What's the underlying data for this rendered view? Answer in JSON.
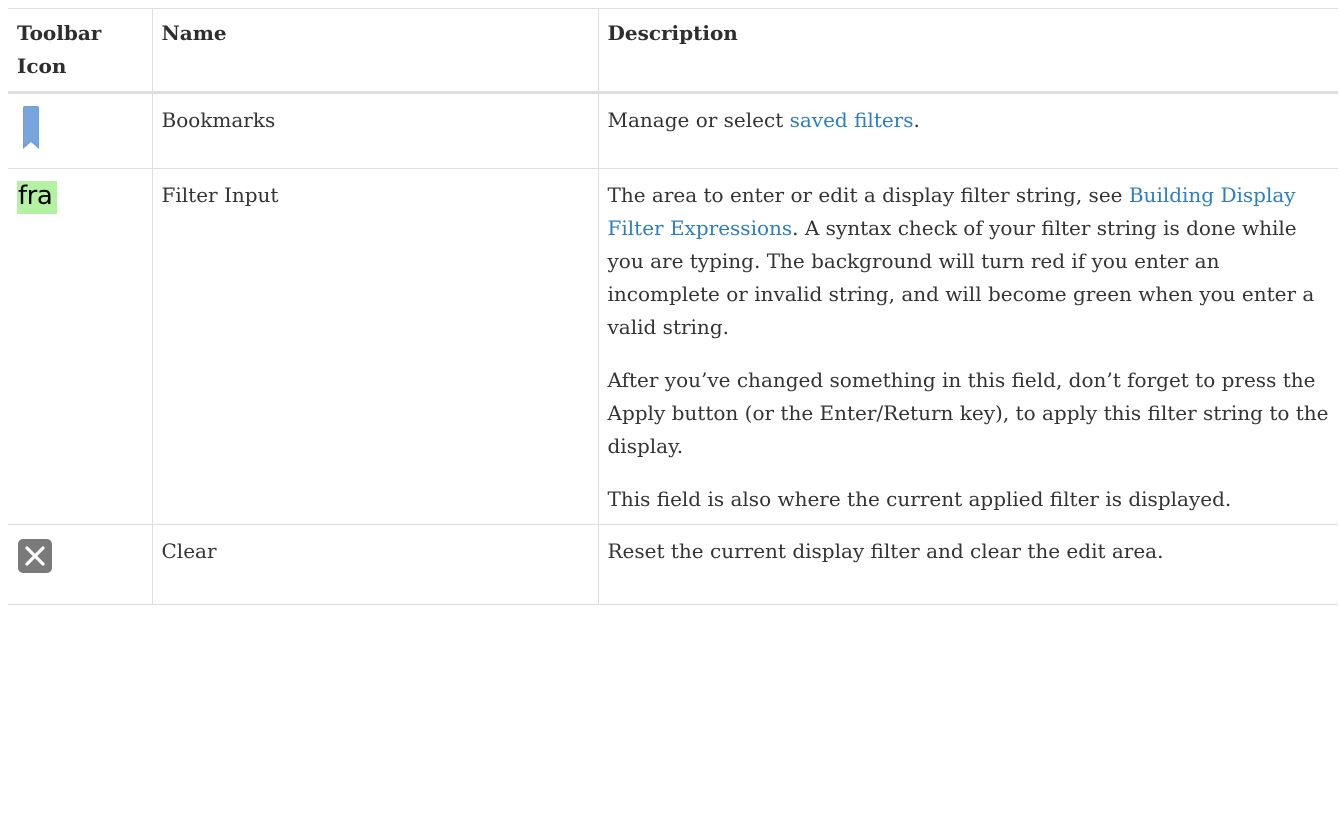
{
  "headers": {
    "icon": "Toolbar Icon",
    "name": "Name",
    "description": "Description"
  },
  "rows": [
    {
      "icon": "bookmark-icon",
      "name": "Bookmarks",
      "desc_before": "Manage or select ",
      "desc_link": "saved filters",
      "desc_after": "."
    },
    {
      "icon": "filter-input-icon",
      "icon_text": "fra",
      "name": "Filter Input",
      "desc_p1_before": "The area to enter or edit a display filter string, see ",
      "desc_p1_link": "Building Display Filter Expressions",
      "desc_p1_after": ". A syntax check of your filter string is done while you are typing. The background will turn red if you enter an incomplete or invalid string, and will become green when you enter a valid string.",
      "desc_p2": "After you’ve changed something in this field, don’t forget to press the Apply button (or the Enter/Return key), to apply this filter string to the display.",
      "desc_p3": "This field is also where the current applied filter is displayed."
    },
    {
      "icon": "clear-icon",
      "name": "Clear",
      "desc": "Reset the current display filter and clear the edit area."
    }
  ],
  "colors": {
    "link": "#2a7ec2",
    "border": "#dedede",
    "bookmark_icon": "#6f9fd8",
    "filter_icon_bg": "#b3f2a2",
    "clear_icon_bg": "#7a7a7a"
  }
}
